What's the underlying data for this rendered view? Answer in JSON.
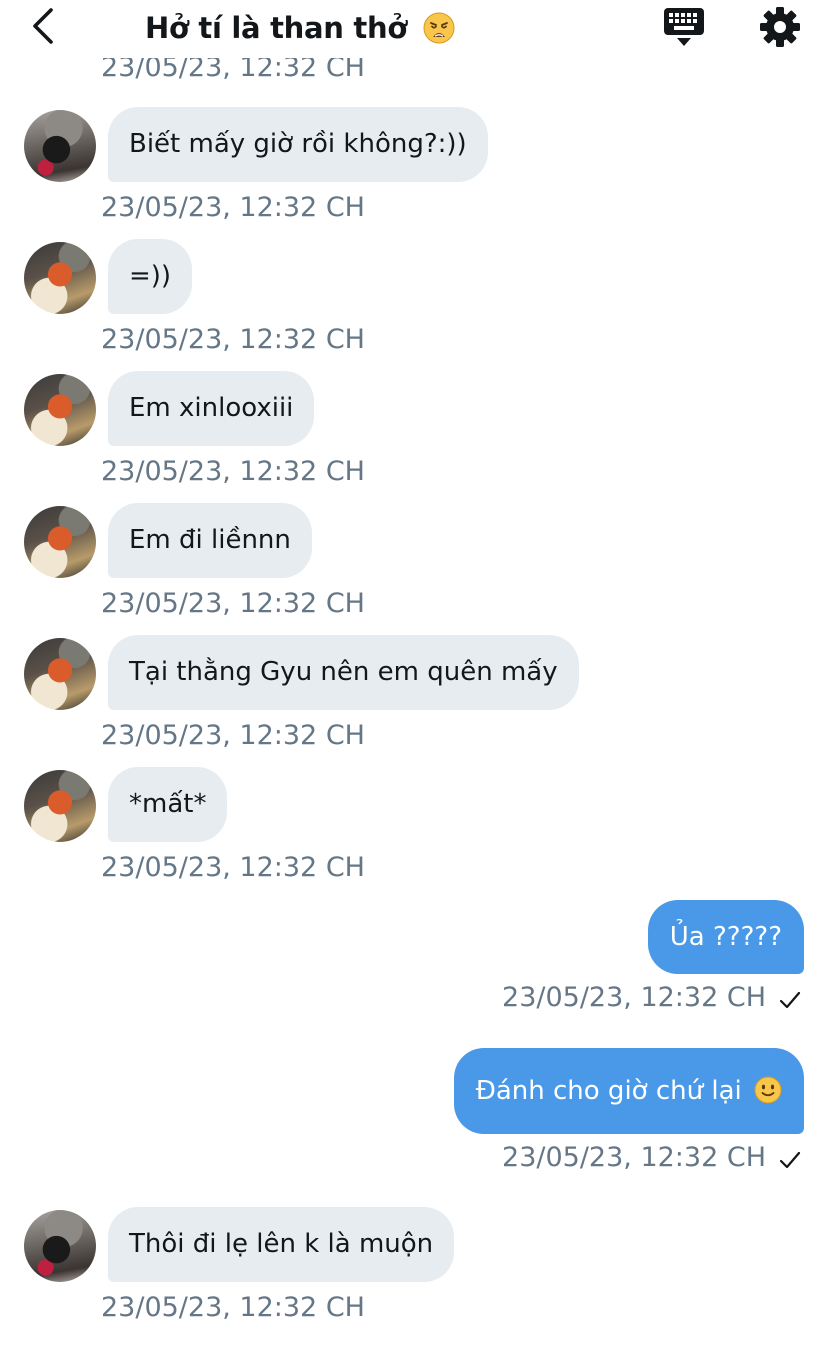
{
  "header": {
    "title": "Hở tí là than thở",
    "title_emoji": "weary-face-emoji",
    "back_icon": "chevron-left-icon",
    "keyboard_icon": "keyboard-icon",
    "settings_icon": "gear-icon"
  },
  "cut_timestamp": "23/05/23, 12:32 CH",
  "messages": [
    {
      "text": "Biết mấy giờ rồi không?:))",
      "time": "23/05/23, 12:32 CH"
    },
    {
      "text": "=))",
      "time": "23/05/23, 12:32 CH"
    },
    {
      "text": "Em xinlooxiii",
      "time": "23/05/23, 12:32 CH"
    },
    {
      "text": "Em đi liềnnn",
      "time": "23/05/23, 12:32 CH"
    },
    {
      "text": "Tại thằng Gyu nên em quên mấy",
      "time": "23/05/23, 12:32 CH"
    },
    {
      "text": "*mất*",
      "time": "23/05/23, 12:32 CH"
    },
    {
      "text": "Ủa ?????",
      "time": "23/05/23, 12:32 CH"
    },
    {
      "text": "Đánh cho giờ chứ lại",
      "emoji": "slightly-smiling-face-emoji",
      "time": "23/05/23, 12:32 CH"
    },
    {
      "text": "Thôi đi lẹ lên k là muộn",
      "time": "23/05/23, 12:32 CH"
    }
  ],
  "colors": {
    "incoming_bubble": "#e6ecf0",
    "outgoing_bubble": "#4a99e9",
    "timestamp": "#657786"
  }
}
